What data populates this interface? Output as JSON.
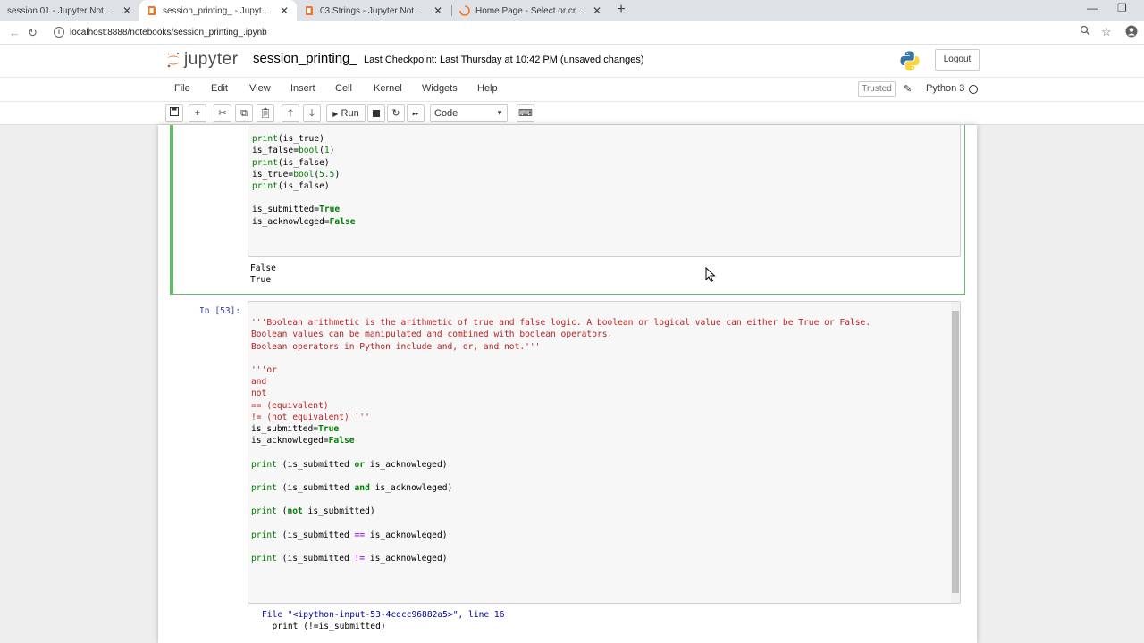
{
  "browser": {
    "tabs": [
      {
        "title": "session 01 - Jupyter Notebook",
        "active": false
      },
      {
        "title": "session_printing_ - Jupyter Notebook",
        "active": true
      },
      {
        "title": "03.Strings - Jupyter Notebook",
        "active": false
      },
      {
        "title": "Home Page - Select or create a notebook",
        "active": false
      }
    ],
    "url": "localhost:8888/notebooks/session_printing_.ipynb"
  },
  "jupyter": {
    "logo_text": "jupyter",
    "notebook_name": "session_printing_",
    "checkpoint": "Last Checkpoint: Last Thursday at 10:42 PM  (unsaved changes)",
    "logout_label": "Logout",
    "menu": [
      "File",
      "Edit",
      "View",
      "Insert",
      "Cell",
      "Kernel",
      "Widgets",
      "Help"
    ],
    "trusted_label": "Trusted",
    "kernel_name": "Python 3",
    "toolbar": {
      "run_label": "Run",
      "cell_type": "Code"
    }
  },
  "cells": {
    "cell1": {
      "code": [
        "print(is_true)",
        "is_false=bool(1)",
        "print(is_false)",
        "is_true=bool(5.5)",
        "print(is_false)",
        "",
        "is_submitted=True",
        "is_acknowleged=False"
      ],
      "output": [
        "False",
        "True"
      ]
    },
    "cell2": {
      "prompt": "In [53]:",
      "code": [
        "'''Boolean arithmetic is the arithmetic of true and false logic. A boolean or logical value can either be True or False.",
        "Boolean values can be manipulated and combined with boolean operators.",
        "Boolean operators in Python include and, or, and not.'''",
        "",
        "'''or",
        "and",
        "not",
        "== (equivalent)",
        "!= (not equivalent) '''",
        "is_submitted=True",
        "is_acknowleged=False",
        "",
        "print (is_submitted or is_acknowleged)",
        "",
        "print (is_submitted and is_acknowleged)",
        "",
        "print (not is_submitted)",
        "",
        "print (is_submitted == is_acknowleged)",
        "",
        "print (is_submitted != is_acknowleged)"
      ],
      "error": [
        "File \"<ipython-input-53-4cdcc96882a5>\", line 16",
        "  print (!=is_submitted)"
      ]
    }
  },
  "colors": {
    "selected_cell": "#66bb6a",
    "prompt": "#303f9f",
    "string": "#ba2121",
    "keyword": "#008000"
  }
}
